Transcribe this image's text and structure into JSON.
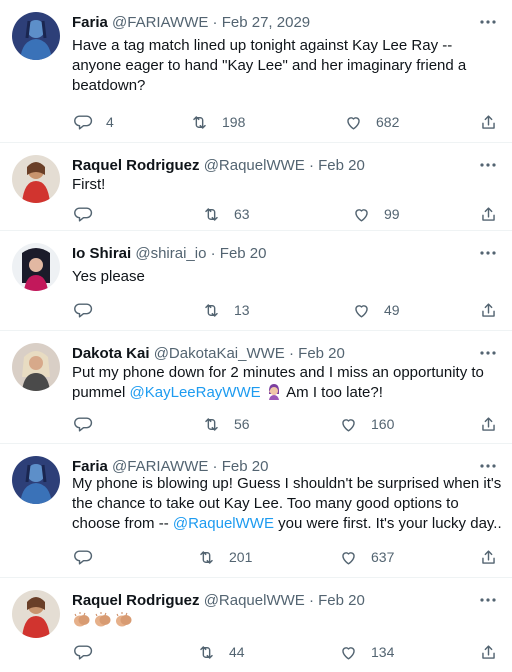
{
  "tweets": [
    {
      "name": "Faria",
      "handle": "@FARIAWWE",
      "date": "Feb 27, 2029",
      "text_before": "Have a tag match lined up tonight against Kay Lee Ray -- anyone eager to hand \"Kay Lee\" and her imaginary friend a beatdown?",
      "reply_count": "4",
      "retweet_count": "198",
      "like_count": "682"
    },
    {
      "name": "Raquel Rodriguez",
      "handle": "@RaquelWWE",
      "date": "Feb 20",
      "text_before": "First!",
      "reply_count": "",
      "retweet_count": "63",
      "like_count": "99"
    },
    {
      "name": "Io Shirai",
      "handle": "@shirai_io",
      "date": "Feb 20",
      "text_before": "Yes please",
      "reply_count": "",
      "retweet_count": "13",
      "like_count": "49"
    },
    {
      "name": "Dakota Kai",
      "handle": "@DakotaKai_WWE",
      "date": "Feb 20",
      "text_before": "Put my phone down for 2 minutes and I miss an opportunity to pummel ",
      "mention": "@KayLeeRayWWE",
      "text_after": " Am I too late?!",
      "reply_count": "",
      "retweet_count": "56",
      "like_count": "160"
    },
    {
      "name": "Faria",
      "handle": "@FARIAWWE",
      "date": "Feb 20",
      "text_before": "My phone is blowing up! Guess I shouldn't be surprised when it's the chance to take out Kay Lee. Too many good options to choose from -- ",
      "mention": "@RaquelWWE",
      "text_after": " you were first. It's your lucky day..",
      "reply_count": "",
      "retweet_count": "201",
      "like_count": "637"
    },
    {
      "name": "Raquel Rodriguez",
      "handle": "@RaquelWWE",
      "date": "Feb 20",
      "reply_count": "",
      "retweet_count": "44",
      "like_count": "134"
    }
  ],
  "separator": " · ",
  "icons": {
    "reply": "reply-icon",
    "retweet": "retweet-icon",
    "like": "like-icon",
    "share": "share-icon",
    "more": "more-options-icon",
    "facepalm": "woman-facepalming-emoji",
    "clap": "clapping-hands-emoji"
  },
  "colors": {
    "text": "#0f1419",
    "secondary": "#536471",
    "link": "#1d9bf0",
    "divider": "#eff3f4"
  }
}
